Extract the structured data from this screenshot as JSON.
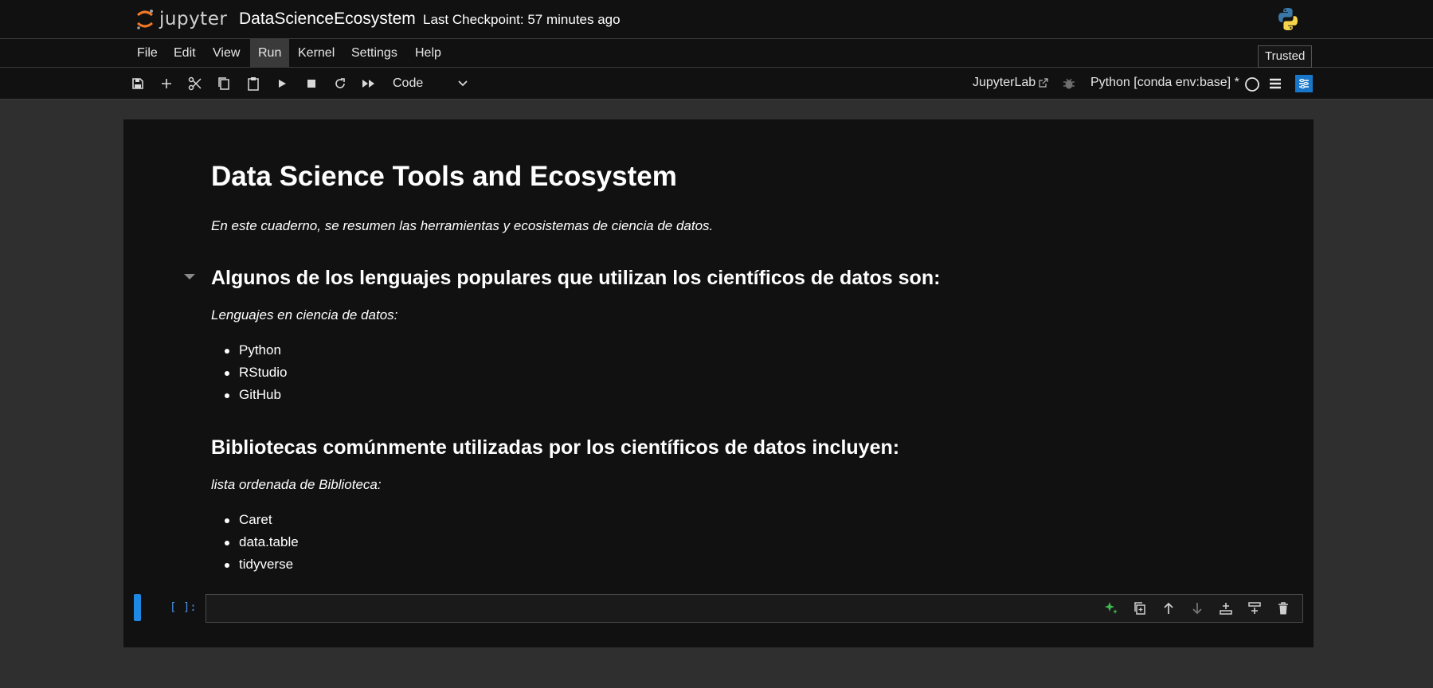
{
  "header": {
    "logo_text": "jupyter",
    "notebook_name": "DataScienceEcosystem",
    "checkpoint": "Last Checkpoint: 57 minutes ago"
  },
  "menu": {
    "items": [
      "File",
      "Edit",
      "View",
      "Run",
      "Kernel",
      "Settings",
      "Help"
    ],
    "active": "Run",
    "trusted_label": "Trusted"
  },
  "toolbar": {
    "buttons": [
      "save-icon",
      "add-cell-icon",
      "cut-icon",
      "copy-icon",
      "paste-icon",
      "run-icon",
      "stop-icon",
      "restart-icon",
      "run-all-icon"
    ],
    "cell_type": "Code",
    "jupyterlab_label": "JupyterLab",
    "kernel_name": "Python [conda env:base] *"
  },
  "notebook": {
    "title": "Data Science Tools and Ecosystem",
    "intro": "En este cuaderno, se resumen las herramientas y ecosistemas de ciencia de datos.",
    "section1": {
      "heading": "Algunos de los lenguajes populares que utilizan los científicos de datos son:",
      "subtitle": "Lenguajes en ciencia de datos:",
      "items": [
        "Python",
        "RStudio",
        "GitHub"
      ]
    },
    "section2": {
      "heading": "Bibliotecas comúnmente utilizadas por los científicos de datos incluyen:",
      "subtitle": "lista ordenada de Biblioteca:",
      "items": [
        "Caret",
        "data.table",
        "tidyverse"
      ]
    },
    "code_cell": {
      "prompt": "[ ]:",
      "content": ""
    },
    "cell_toolbar": [
      "ai-sparkle-icon",
      "duplicate-icon",
      "move-up-icon",
      "move-down-icon",
      "insert-above-icon",
      "insert-below-icon",
      "delete-icon"
    ]
  },
  "colors": {
    "background": "#2f2f2f",
    "panel": "#111111",
    "accent_blue": "#1e88e5",
    "prompt_blue": "#4a90e2",
    "sparkle_green": "#3fb950",
    "jupyter_orange": "#f37726"
  }
}
